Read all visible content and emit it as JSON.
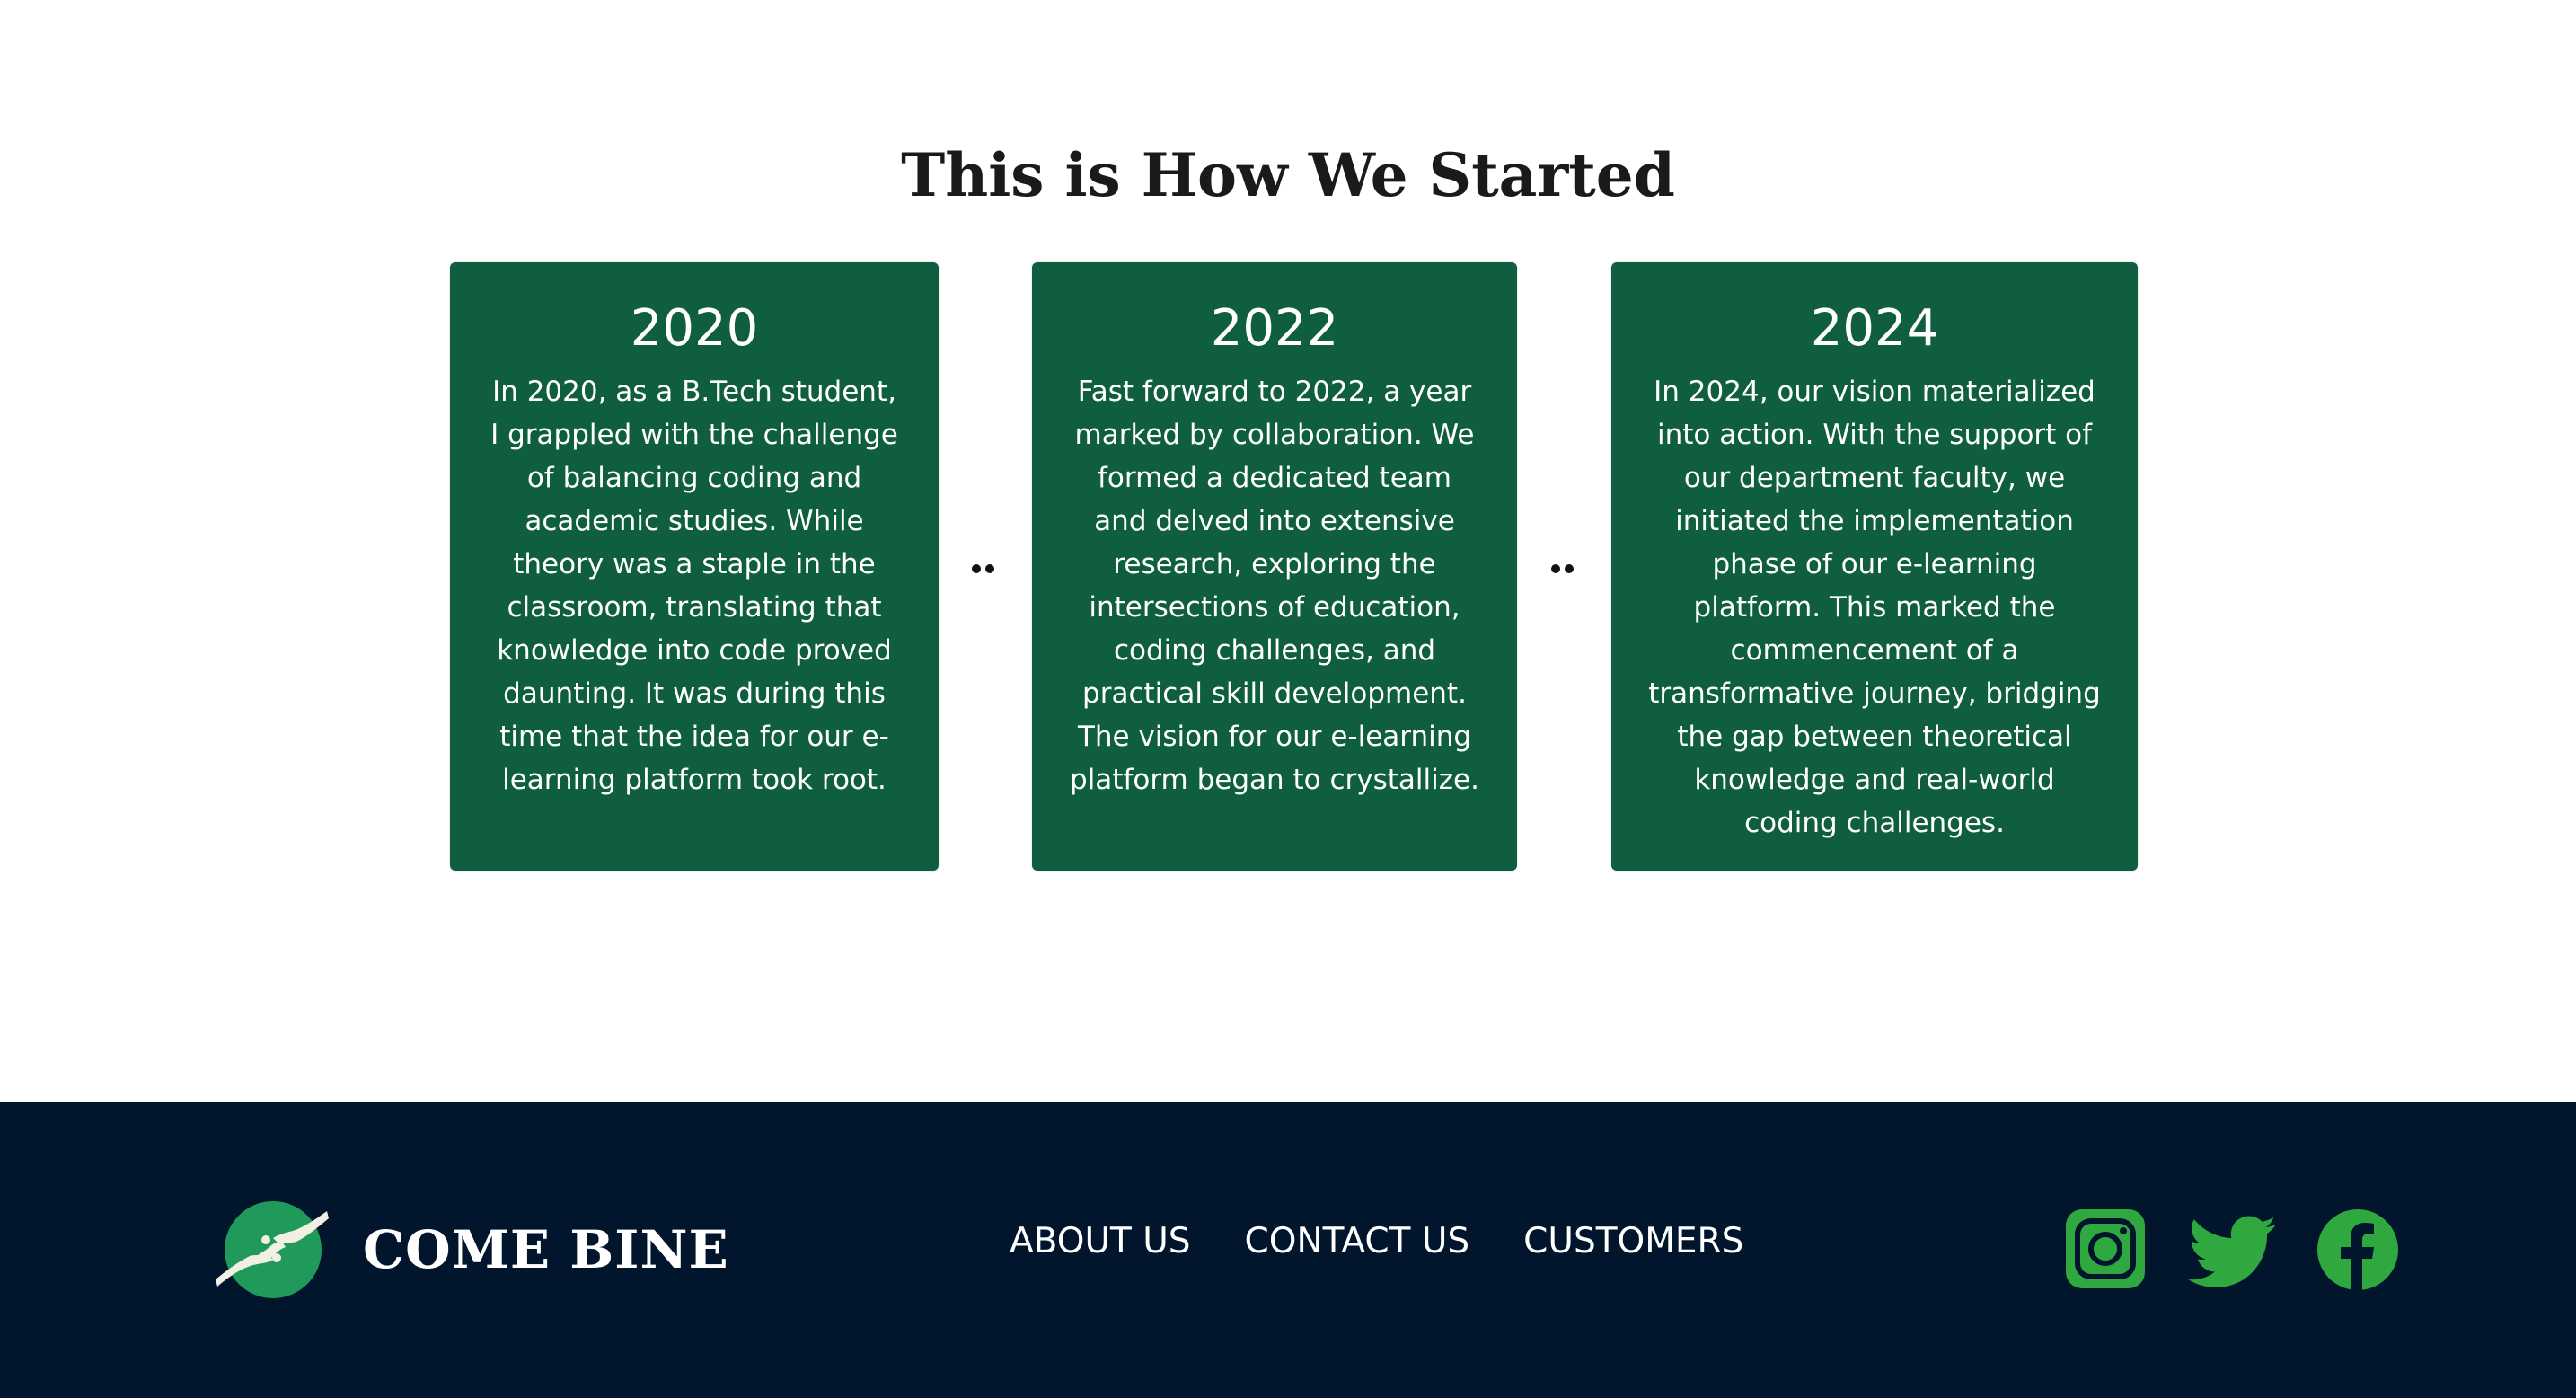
{
  "page": {
    "title": "This is How We Started"
  },
  "timeline": [
    {
      "year": "2020",
      "text": "In 2020, as a B.Tech student, I grappled with the challenge of balancing coding and academic studies. While theory was a staple in the classroom, translating that knowledge into code proved daunting. It was during this time that the idea for our e-learning platform took root."
    },
    {
      "year": "2022",
      "text": "Fast forward to 2022, a year marked by collaboration. We formed a dedicated team and delved into extensive research, exploring the intersections of education, coding challenges, and practical skill development. The vision for our e-learning platform began to crystallize."
    },
    {
      "year": "2024",
      "text": "In 2024, our vision materialized into action. With the support of our department faculty, we initiated the implementation phase of our e-learning platform. This marked the commencement of a transformative journey, bridging the gap between theoretical knowledge and real-world coding challenges."
    }
  ],
  "footer": {
    "brand": "COME BINE",
    "nav": [
      "ABOUT US",
      "CONTACT US",
      "CUSTOMERS"
    ],
    "social_icons": [
      "instagram-icon",
      "twitter-icon",
      "facebook-icon"
    ]
  },
  "colors": {
    "card_background": "#0e5e3f",
    "footer_background": "#01152d",
    "social_green": "#2ea83f",
    "logo_green": "#1f9a5a"
  }
}
